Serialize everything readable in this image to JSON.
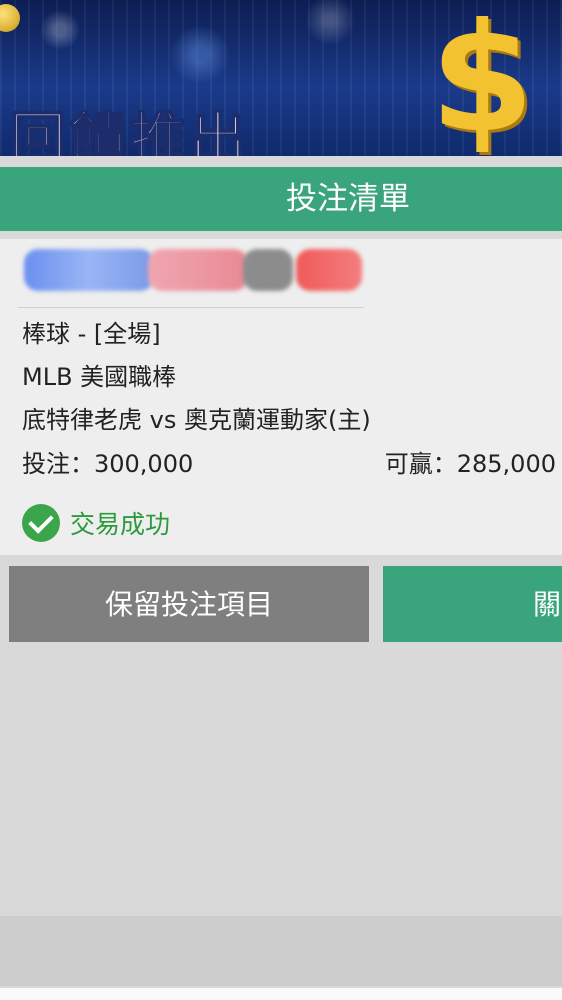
{
  "banner": {
    "headline": "回饋推出"
  },
  "dialog": {
    "title": "投注清單",
    "bet": {
      "sport_market": "棒球 - [全場]",
      "league": "MLB 美國職棒",
      "match": "底特律老虎 vs 奧克蘭運動家(主)",
      "stake": "投注：300,000",
      "potential_win": "可贏：285,000",
      "status": "交易成功"
    },
    "buttons": {
      "keep": "保留投注項目",
      "close": "關"
    }
  },
  "colors": {
    "accent_green": "#3aa57c",
    "success_green": "#3aa54a",
    "button_gray": "#7f7f7f"
  }
}
